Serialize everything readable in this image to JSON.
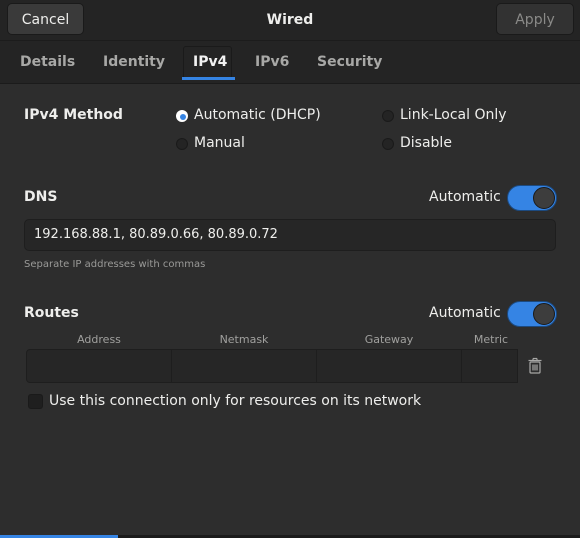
{
  "header": {
    "title": "Wired",
    "cancel_label": "Cancel",
    "apply_label": "Apply"
  },
  "tabs": [
    {
      "label": "Details"
    },
    {
      "label": "Identity"
    },
    {
      "label": "IPv4"
    },
    {
      "label": "IPv6"
    },
    {
      "label": "Security"
    }
  ],
  "active_tab": "IPv4",
  "ipv4_method": {
    "label": "IPv4 Method",
    "options": [
      {
        "label": "Automatic (DHCP)",
        "checked": true
      },
      {
        "label": "Link-Local Only",
        "checked": false
      },
      {
        "label": "Manual",
        "checked": false
      },
      {
        "label": "Disable",
        "checked": false
      }
    ]
  },
  "dns": {
    "label": "DNS",
    "automatic_label": "Automatic",
    "automatic_on": true,
    "value": "192.168.88.1, 80.89.0.66, 80.89.0.72",
    "hint": "Separate IP addresses with commas"
  },
  "routes": {
    "label": "Routes",
    "automatic_label": "Automatic",
    "automatic_on": true,
    "columns": [
      "Address",
      "Netmask",
      "Gateway",
      "Metric"
    ]
  },
  "only_local": {
    "label": "Use this connection only for resources on its network",
    "checked": false
  },
  "colors": {
    "accent": "#3584e4",
    "background": "#2d2d2d",
    "headerbar": "#242424"
  }
}
